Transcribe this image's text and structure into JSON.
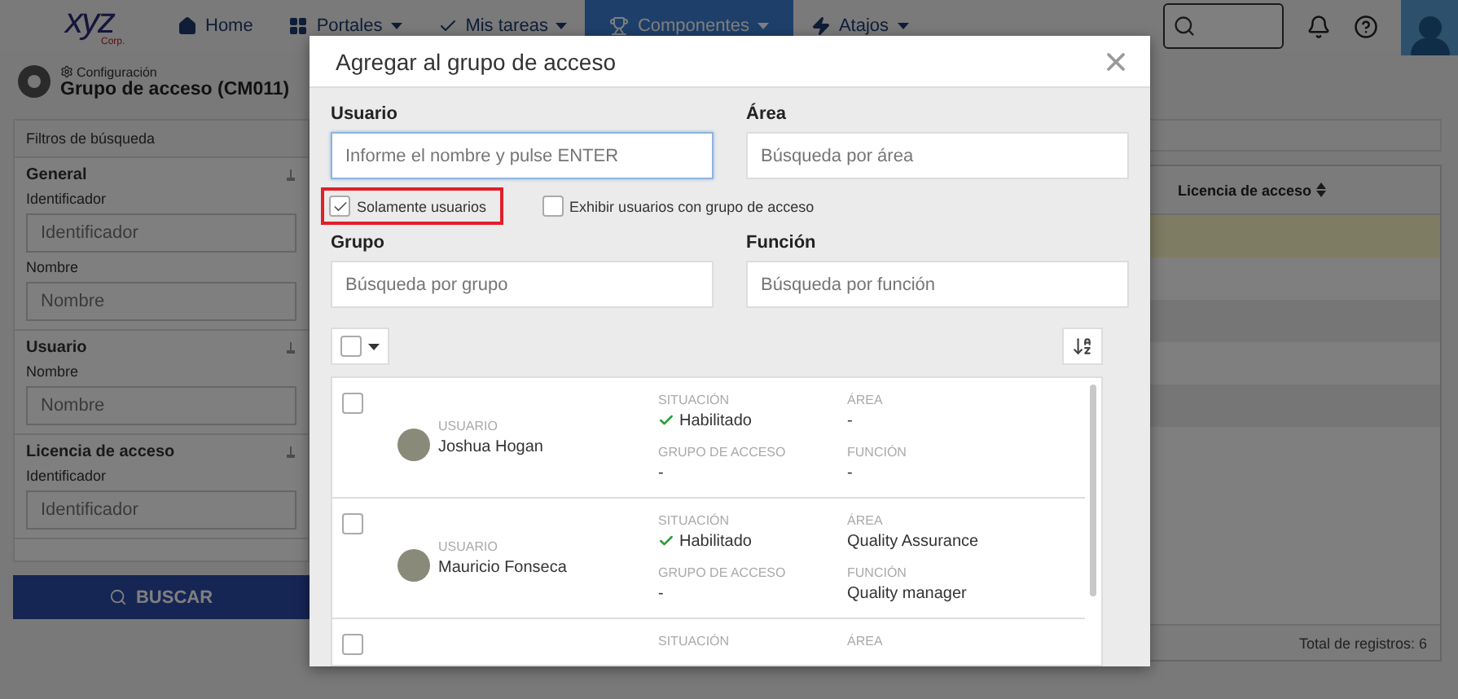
{
  "navbar": {
    "logo": {
      "text": "xyz",
      "subtext": "Corp."
    },
    "items": [
      {
        "label": "Home",
        "dropdown": false,
        "selected": false
      },
      {
        "label": "Portales",
        "dropdown": true,
        "selected": false
      },
      {
        "label": "Mis tareas",
        "dropdown": true,
        "selected": false
      },
      {
        "label": "Componentes",
        "dropdown": true,
        "selected": true
      },
      {
        "label": "Atajos",
        "dropdown": true,
        "selected": false
      }
    ]
  },
  "page_header": {
    "breadcrumb": "Configuración",
    "title": "Grupo de acceso (CM011)"
  },
  "filters": {
    "title": "Filtros de búsqueda",
    "sections": [
      {
        "title": "General",
        "fields": [
          {
            "label": "Identificador",
            "placeholder": "Identificador"
          },
          {
            "label": "Nombre",
            "placeholder": "Nombre"
          }
        ]
      },
      {
        "title": "Usuario",
        "fields": [
          {
            "label": "Nombre",
            "placeholder": "Nombre"
          }
        ]
      },
      {
        "title": "Licencia de acceso",
        "fields": [
          {
            "label": "Identificador",
            "placeholder": "Identificador"
          }
        ]
      }
    ],
    "search_button": "BUSCAR"
  },
  "table": {
    "columns": [
      "Licencia de acceso"
    ],
    "rows": [
      {
        "selected": true
      },
      {
        "selected": false
      },
      {
        "selected": false
      },
      {
        "selected": false
      },
      {
        "selected": false
      },
      {
        "selected": false
      }
    ],
    "footer": "Total de registros: 6"
  },
  "dialog": {
    "title": "Agregar al grupo de acceso",
    "fields": [
      {
        "label": "Usuario",
        "placeholder": "Informe el nombre y pulse ENTER",
        "focused": true
      },
      {
        "label": "Área",
        "placeholder": "Búsqueda por área",
        "focused": false
      }
    ],
    "options": [
      {
        "label": "Solamente usuarios",
        "checked": true,
        "highlighted": true
      },
      {
        "label": "Exhibir usuarios con grupo de acceso",
        "checked": false,
        "highlighted": false
      }
    ],
    "fields_2": [
      {
        "label": "Grupo",
        "placeholder": "Búsqueda por grupo",
        "focused": false
      },
      {
        "label": "Función",
        "placeholder": "Búsqueda por función",
        "focused": false
      }
    ],
    "select_all": {
      "checked": false
    },
    "results": [
      {
        "checked": false,
        "user_label": "USUARIO",
        "user": "Joshua Hogan",
        "status_label": "SITUACIÓN",
        "status": "Habilitado",
        "area_label": "ÁREA",
        "area": "-",
        "group_label": "GRUPO DE ACCESO",
        "group": "-",
        "role_label": "FUNCIÓN",
        "role": "-"
      },
      {
        "checked": false,
        "user_label": "USUARIO",
        "user": "Mauricio Fonseca",
        "status_label": "SITUACIÓN",
        "status": "Habilitado",
        "area_label": "ÁREA",
        "area": "Quality Assurance",
        "group_label": "GRUPO DE ACCESO",
        "group": "-",
        "role_label": "FUNCIÓN",
        "role": "Quality manager"
      },
      {
        "checked": false,
        "status_label": "SITUACIÓN",
        "area_label": "ÁREA"
      }
    ]
  }
}
